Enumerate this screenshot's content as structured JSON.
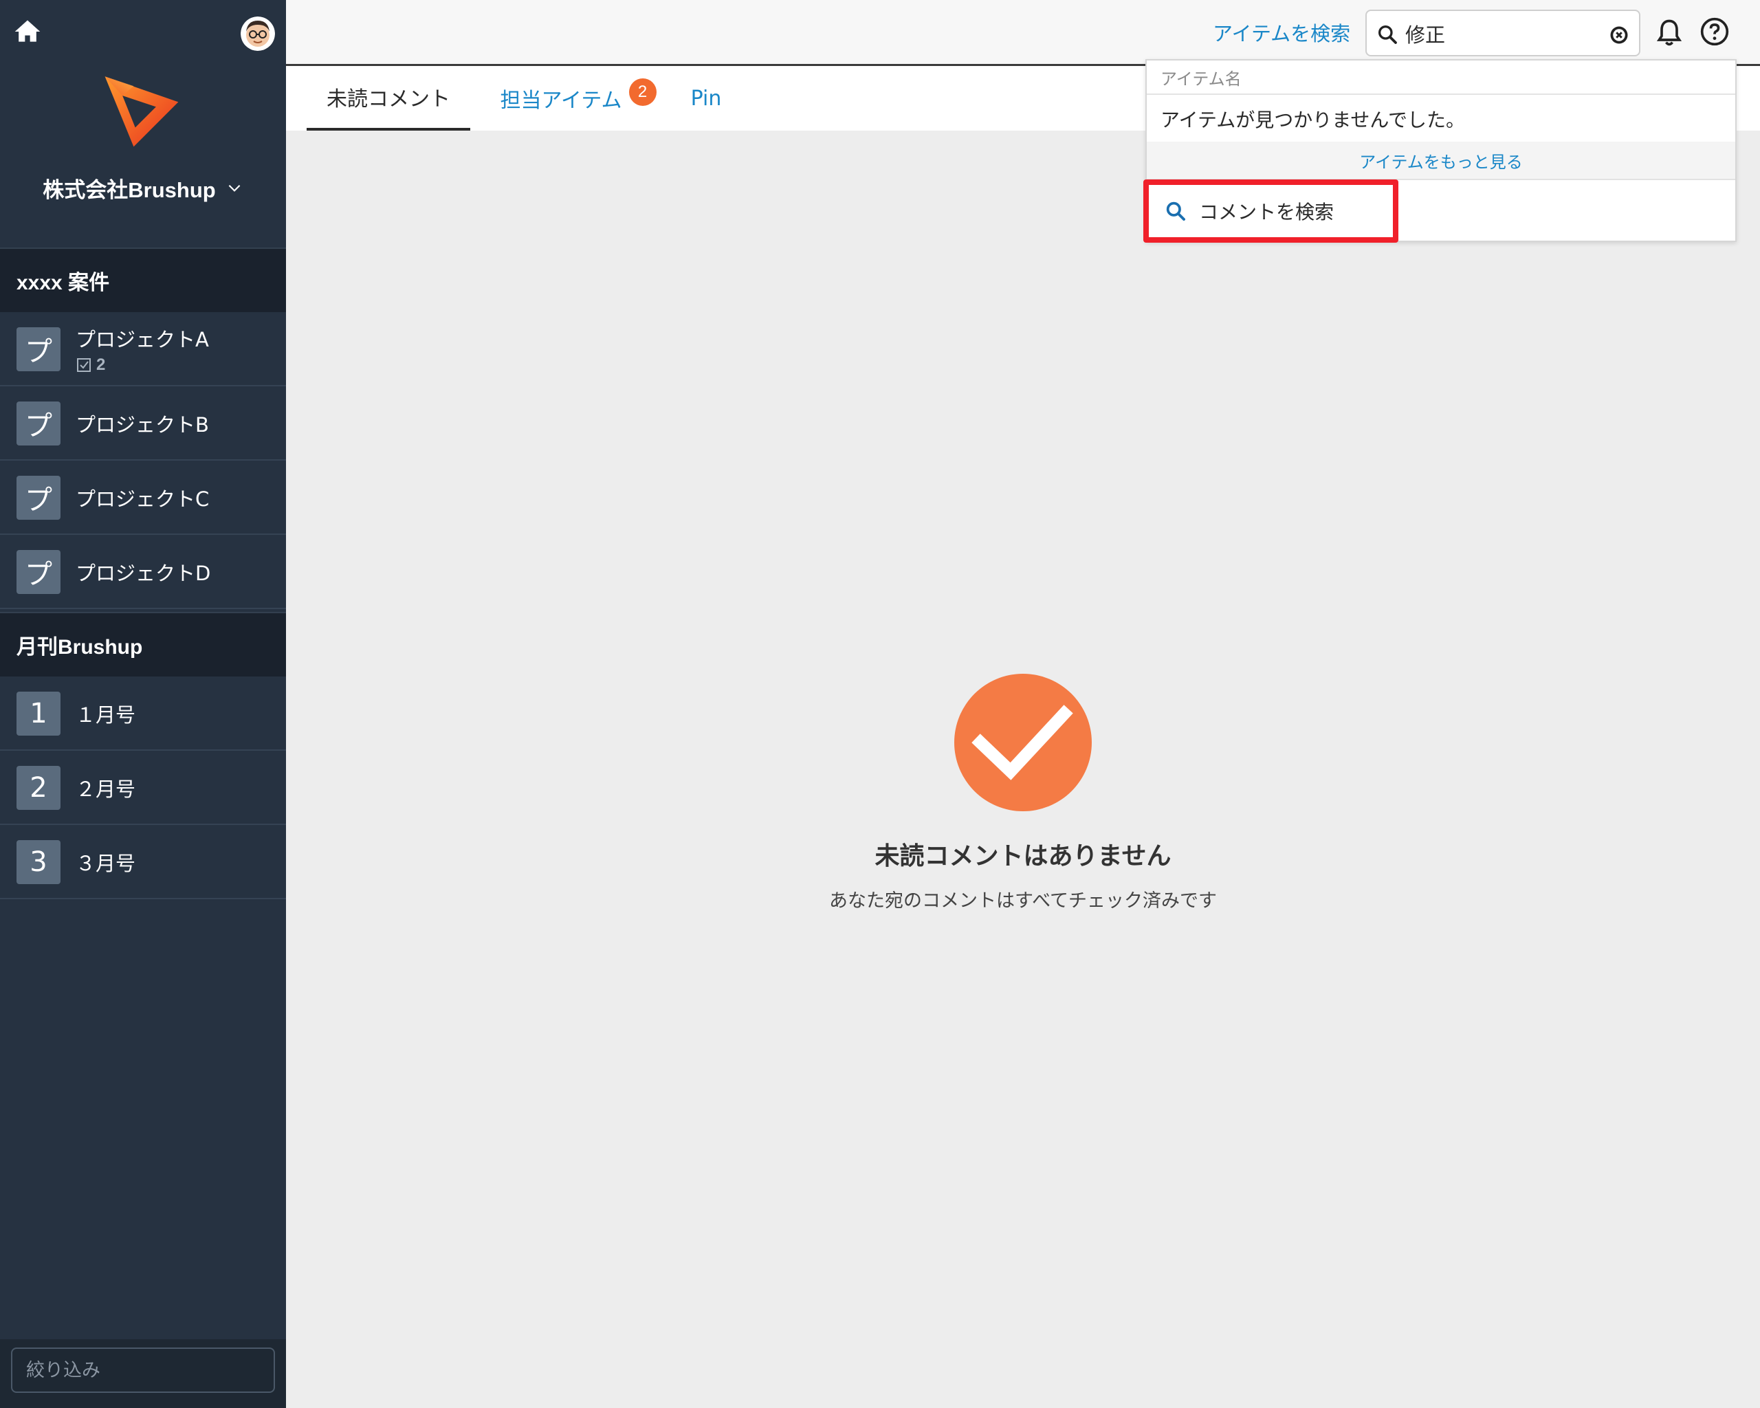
{
  "sidebar": {
    "company": "株式会社Brushup",
    "sections": [
      {
        "title": "xxxx 案件",
        "items": [
          {
            "tile": "プ",
            "name": "プロジェクトA",
            "count": "2"
          },
          {
            "tile": "プ",
            "name": "プロジェクトB"
          },
          {
            "tile": "プ",
            "name": "プロジェクトC"
          },
          {
            "tile": "プ",
            "name": "プロジェクトD"
          }
        ]
      },
      {
        "title": "月刊Brushup",
        "items": [
          {
            "tile": "1",
            "name": "１月号"
          },
          {
            "tile": "2",
            "name": "２月号"
          },
          {
            "tile": "3",
            "name": "３月号"
          }
        ]
      }
    ],
    "filter_placeholder": "絞り込み",
    "icons": [
      "home-icon",
      "avatar",
      "brand-logo",
      "chevron-down-icon",
      "checkbox-icon"
    ]
  },
  "topbar": {
    "search_link": "アイテムを検索",
    "search_value": "修正",
    "icons": [
      "search-icon",
      "clear-icon",
      "bell-icon",
      "help-icon"
    ]
  },
  "tabs": [
    {
      "label": "未読コメント",
      "active": true
    },
    {
      "label": "担当アイテム",
      "badge": "2"
    },
    {
      "label": "Pin"
    }
  ],
  "dropdown": {
    "section_label": "アイテム名",
    "no_result": "アイテムが見つかりませんでした。",
    "more_link": "アイテムをもっと見る",
    "comment_search": "コメントを検索"
  },
  "empty_state": {
    "title": "未読コメントはありません",
    "description": "あなた宛のコメントはすべてチェック済みです"
  },
  "colors": {
    "sidebar_bg": "#263241",
    "section_header_bg": "#1a222d",
    "accent_orange": "#f47b45",
    "link_blue": "#1a87c8",
    "highlight_red": "#f0202a",
    "content_bg": "#ededed"
  }
}
